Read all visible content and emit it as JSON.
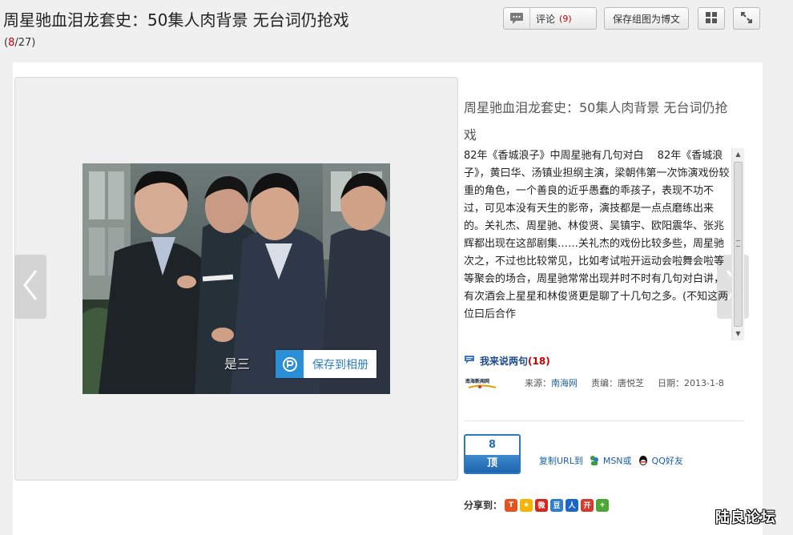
{
  "header": {
    "title": "周星驰血泪龙套史：50集人肉背景 无台词仍抢戏",
    "counter_current": "8",
    "counter_total": "27"
  },
  "toolbar": {
    "comment_label": "评论",
    "comment_count": "9",
    "save_blog_label": "保存组图为博文",
    "grid_icon": "grid-icon",
    "fullscreen_icon": "fullscreen-icon"
  },
  "viewer": {
    "save_album_label": "保存到相册",
    "photo_subtitle": "是三",
    "prev_icon": "chevron-left-icon",
    "next_icon": "chevron-right-icon"
  },
  "article": {
    "title": "周星驰血泪龙套史：50集人肉背景 无台词仍抢戏",
    "body": "82年《香城浪子》中周星驰有几句对白　 82年《香城浪子》，黄曰华、汤镇业担纲主演，梁朝伟第一次饰演戏份较重的角色，一个善良的近乎愚蠢的乖孩子，表现不功不过，可见本没有天生的影帝，演技都是一点点磨练出来的。关礼杰、周星驰、林俊贤、吴镇宇、欧阳震华、张兆辉都出现在这部剧集……关礼杰的戏份比较多些，周星驰次之，不过也比较常见，比如考试啦开运动会啦舞会啦等等聚会的场合，周星驰常常出现并时不时有几句对白讲，有次酒会上星星和林俊贤更是聊了十几句之多。(不知这两位曰后合作"
  },
  "comments": {
    "say_label": "我来说两句",
    "count": "18"
  },
  "meta": {
    "logo_text": "南海新闻网",
    "source_label": "来源：",
    "source_value": "南海网",
    "editor_label": "责编：",
    "editor_value": "唐悦芝",
    "date_label": "日期：",
    "date_value": "2013-1-8"
  },
  "vote": {
    "count": "8",
    "action": "顶"
  },
  "share": {
    "copy_url": "复制URL到",
    "msn": "MSN或",
    "qq": "QQ好友",
    "share_to_label": "分享到："
  },
  "watermark": "陆良论坛",
  "colors": {
    "accent_blue": "#2a79c0",
    "highlight_red": "#cc0000"
  }
}
